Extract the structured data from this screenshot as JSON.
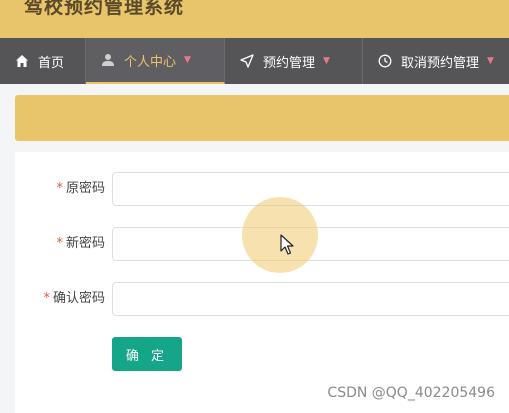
{
  "app": {
    "title": "驾校预约管理系统"
  },
  "nav": {
    "items": [
      {
        "label": "首页",
        "icon": "home-icon"
      },
      {
        "label": "个人中心",
        "icon": "user-icon",
        "active": true
      },
      {
        "label": "预约管理",
        "icon": "send-icon"
      },
      {
        "label": "取消预约管理",
        "icon": "clock-icon"
      }
    ]
  },
  "form": {
    "required_mark": "*",
    "old_password_label": "原密码",
    "new_password_label": "新密码",
    "confirm_password_label": "确认密码",
    "old_password_value": "",
    "new_password_value": "",
    "confirm_password_value": "",
    "submit_label": "确 定"
  },
  "watermark": "CSDN @QQ_402205496",
  "colors": {
    "banner": "#e8c46a",
    "navbar": "#555457",
    "accent_button": "#15a589",
    "required": "#e2574c"
  }
}
